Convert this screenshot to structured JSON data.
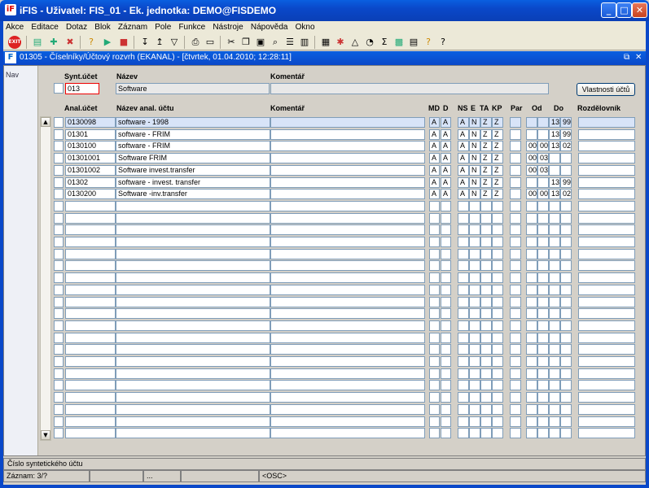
{
  "window": {
    "title": "iFIS - Uživatel: FIS_01 - Ek. jednotka: DEMO@FISDEMO",
    "app_icon": "iF",
    "min": "_",
    "max": "□",
    "close": "✕"
  },
  "menu": [
    "Akce",
    "Editace",
    "Dotaz",
    "Blok",
    "Záznam",
    "Pole",
    "Funkce",
    "Nástroje",
    "Nápověda",
    "Okno"
  ],
  "toolbar": {
    "exit_label": "EXIT",
    "icons": [
      "save-icon",
      "insert-record-icon",
      "delete-record-icon",
      "enter-query-icon",
      "execute-query-icon",
      "cancel-query-icon",
      "sort-asc-icon",
      "sort-desc-icon",
      "filter-icon",
      "print-icon",
      "print-setup-icon",
      "cut-icon",
      "copy-icon",
      "paste-icon",
      "find-icon",
      "list-icon",
      "columns-icon",
      "export-icon",
      "tools-icon",
      "warning-icon",
      "clock-icon",
      "sum-icon",
      "excel-icon",
      "calculator-icon",
      "help-icon",
      "context-help-icon"
    ]
  },
  "inner": {
    "title": "01305 - Číselníky/Účtový rozvrh (EKANAL) - [čtvrtek, 01.04.2010; 12:28:11]",
    "icon": "F",
    "nav_label": "Nav"
  },
  "header": {
    "synt_label": "Synt.účet",
    "nazev_label": "Název",
    "komentar_label": "Komentář",
    "synt_value": "013",
    "nazev_value": "Software",
    "komentar_value": "",
    "button": "Vlastnosti účtů"
  },
  "columns": {
    "anal": "Anal.účet",
    "nazev": "Název anal. účtu",
    "komentar": "Komentář",
    "md": "MD",
    "d": "D",
    "ns": "NS",
    "e": "E",
    "ta": "TA",
    "kp": "KP",
    "par": "Par",
    "od": "Od",
    "do": "Do",
    "rozd": "Rozdělovník"
  },
  "rows": [
    {
      "anal": "0130098",
      "nazev": "software - 1998",
      "md": "A",
      "d": "A",
      "ns": "A",
      "e": "N",
      "ta": "Z",
      "kp": "Z",
      "od1": "",
      "od2": "",
      "do1": "13",
      "do2": "99"
    },
    {
      "anal": "01301",
      "nazev": "software - FRIM",
      "md": "A",
      "d": "A",
      "ns": "A",
      "e": "N",
      "ta": "Z",
      "kp": "Z",
      "od1": "",
      "od2": "",
      "do1": "13",
      "do2": "99"
    },
    {
      "anal": "0130100",
      "nazev": "software - FRIM",
      "md": "A",
      "d": "A",
      "ns": "A",
      "e": "N",
      "ta": "Z",
      "kp": "Z",
      "od1": "00",
      "od2": "00",
      "do1": "13",
      "do2": "02"
    },
    {
      "anal": "01301001",
      "nazev": "Software FRIM",
      "md": "A",
      "d": "A",
      "ns": "A",
      "e": "N",
      "ta": "Z",
      "kp": "Z",
      "od1": "00",
      "od2": "03",
      "do1": "",
      "do2": ""
    },
    {
      "anal": "01301002",
      "nazev": "Software invest.transfer",
      "md": "A",
      "d": "A",
      "ns": "A",
      "e": "N",
      "ta": "Z",
      "kp": "Z",
      "od1": "00",
      "od2": "03",
      "do1": "",
      "do2": ""
    },
    {
      "anal": "01302",
      "nazev": "software - invest. transfer",
      "md": "A",
      "d": "A",
      "ns": "A",
      "e": "N",
      "ta": "Z",
      "kp": "Z",
      "od1": "",
      "od2": "",
      "do1": "13",
      "do2": "99"
    },
    {
      "anal": "0130200",
      "nazev": "Software -inv.transfer",
      "md": "A",
      "d": "A",
      "ns": "A",
      "e": "N",
      "ta": "Z",
      "kp": "Z",
      "od1": "00",
      "od2": "00",
      "do1": "13",
      "do2": "02"
    }
  ],
  "status": {
    "hint": "Číslo syntetického účtu",
    "record": "Záznam: 3/?",
    "seg2": "",
    "seg3": "...",
    "seg4": "",
    "mode": "<OSC>"
  }
}
